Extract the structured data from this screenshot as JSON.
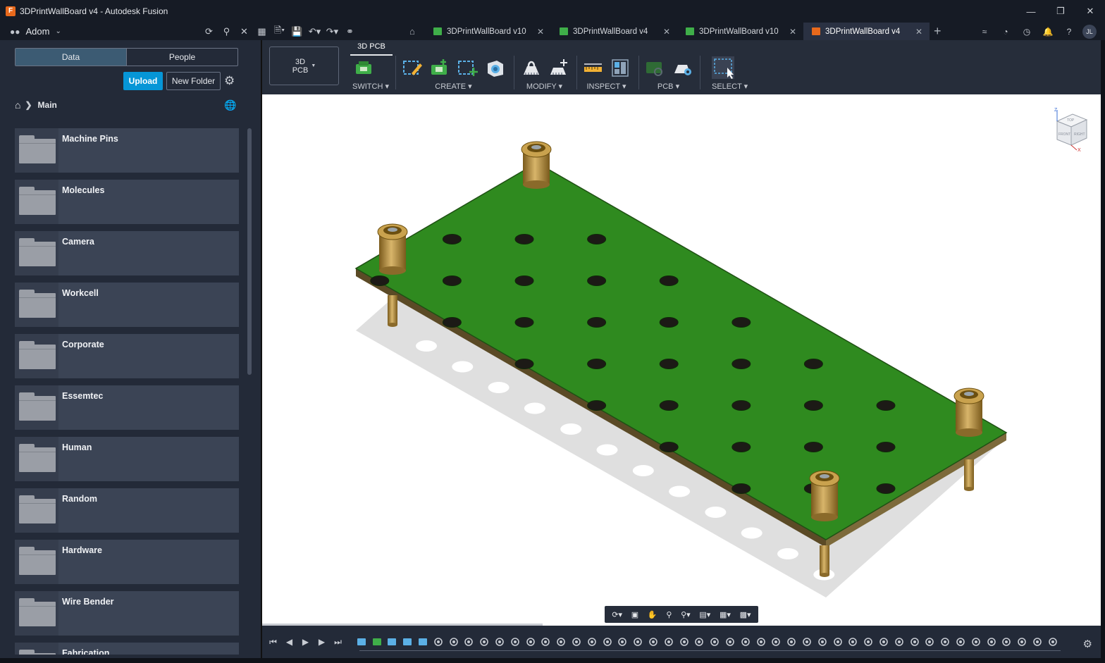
{
  "window": {
    "title": "3DPrintWallBoard v4 - Autodesk Fusion",
    "app_icon": "F",
    "minimize": "—",
    "restore": "❐",
    "close": "✕"
  },
  "appbar": {
    "team": "Adom",
    "tabs": [
      {
        "label": "3DPrintWallBoard v10",
        "icon_color": "#3fae49"
      },
      {
        "label": "3DPrintWallBoard v4",
        "icon_color": "#3fae49"
      },
      {
        "label": "3DPrintWallBoard v10",
        "icon_color": "#3fae49"
      },
      {
        "label": "3DPrintWallBoard v4",
        "icon_color": "#e8691c"
      }
    ],
    "user_initials": "JL"
  },
  "datapanel": {
    "tab_data": "Data",
    "tab_people": "People",
    "upload": "Upload",
    "new_folder": "New Folder",
    "breadcrumb": "Main",
    "folders": [
      "Machine Pins",
      "Molecules",
      "Camera",
      "Workcell",
      "Corporate",
      "Essemtec",
      "Human",
      "Random",
      "Hardware",
      "Wire Bender",
      "Fabrication"
    ]
  },
  "toolbar": {
    "workspace_line1": "3D",
    "workspace_line2": "PCB",
    "active_tab": "3D PCB",
    "groups": {
      "switch": "SWITCH",
      "create": "CREATE",
      "modify": "MODIFY",
      "inspect": "INSPECT",
      "pcb": "PCB",
      "select": "SELECT"
    }
  },
  "viewcube": {
    "top": "TOP",
    "front": "FRONT",
    "right": "RIGHT",
    "axis_z": "Z",
    "axis_x": "X"
  },
  "colors": {
    "accent": "#0696d7",
    "pcb_green": "#2f8a1f",
    "brass": "#b9923f",
    "background": "#232a38"
  }
}
